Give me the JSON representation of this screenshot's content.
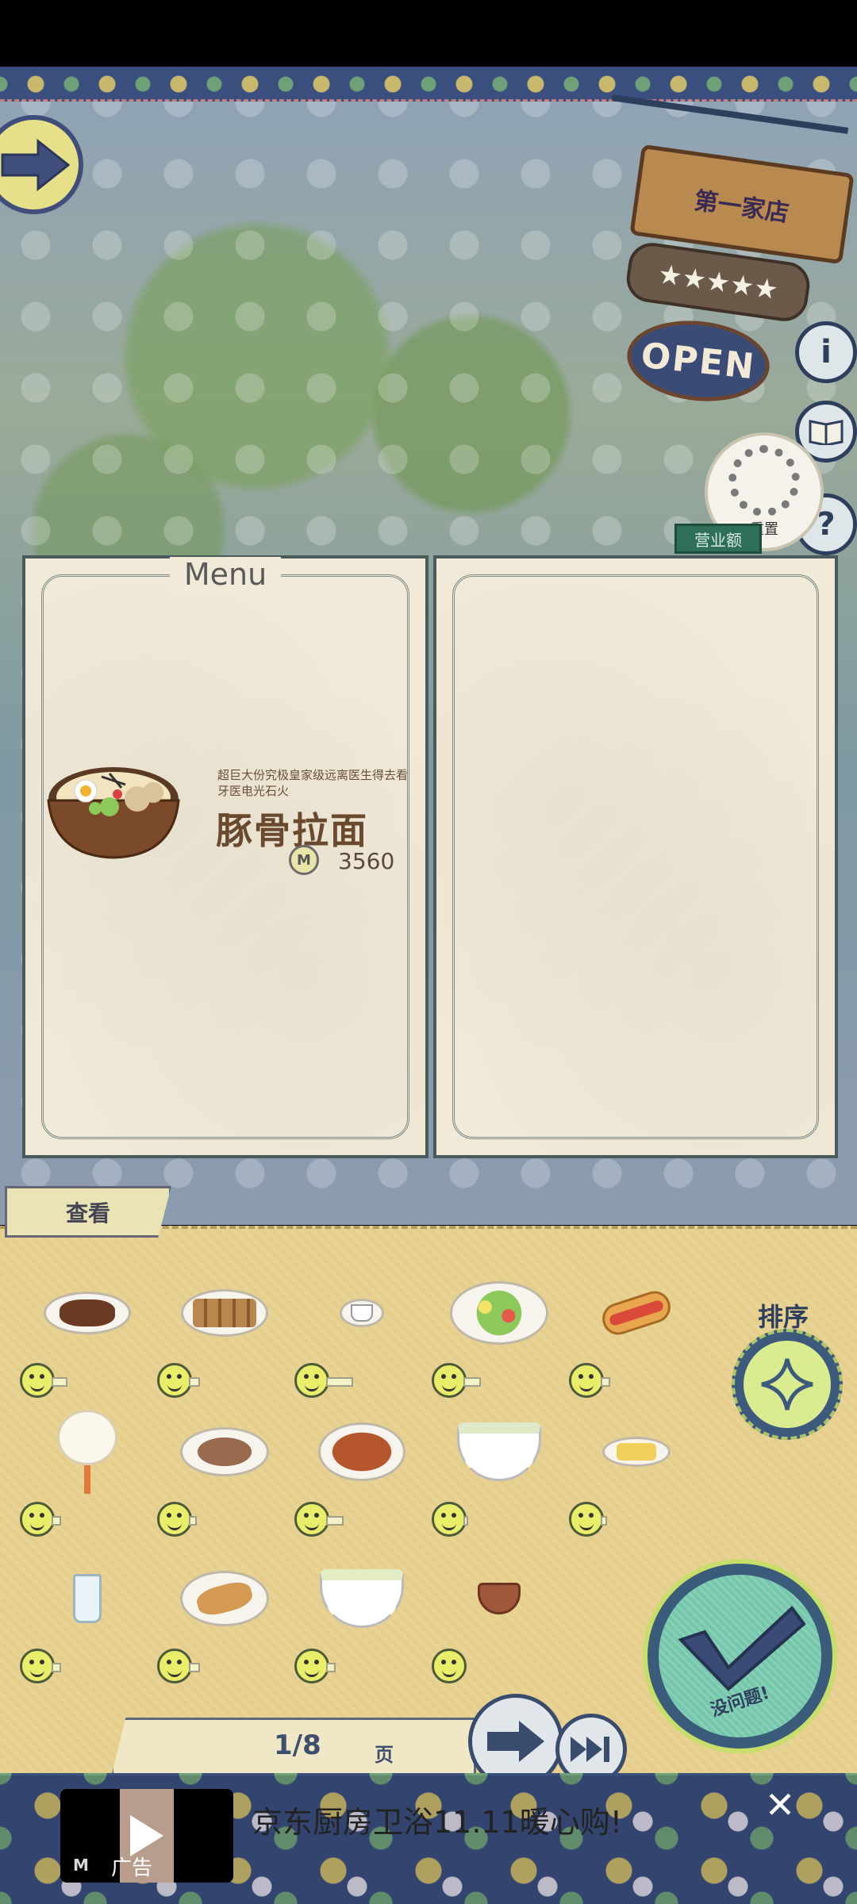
{
  "shop": {
    "name": "第一家店",
    "stars": "★★★★★",
    "open_label": "OPEN",
    "reset_label": "重置",
    "revenue_label": "营业额",
    "info_icon": "i",
    "help_icon": "?"
  },
  "menu": {
    "title": "Menu",
    "dish": {
      "description": "超巨大份究极皇家级远离医生得去看牙医电光石火",
      "name": "豚骨拉面",
      "currency_symbol": "M",
      "price": "3560"
    }
  },
  "panel": {
    "tab_label": "查看",
    "sort_label": "排序",
    "confirm_label": "没问题!",
    "page_number": "1/8",
    "page_unit": "页",
    "items": [
      {
        "name": "braised-meat",
        "level": 0.5
      },
      {
        "name": "skewers",
        "level": 0.35
      },
      {
        "name": "coffee-cup",
        "level": 0.85
      },
      {
        "name": "salad-plate",
        "level": 0.55
      },
      {
        "name": "hot-dog",
        "level": 0.3
      },
      {
        "name": "cotton-candy",
        "level": 0.3
      },
      {
        "name": "tofu-dish",
        "level": 0.25
      },
      {
        "name": "noodle-plate",
        "level": 0.55
      },
      {
        "name": "noodle-soup",
        "level": 0.15
      },
      {
        "name": "egg-roll",
        "level": 0.2
      },
      {
        "name": "glass-of-water",
        "level": 0.3
      },
      {
        "name": "fried-fish",
        "level": 0.35
      },
      {
        "name": "soup-bowl",
        "level": 0.3
      },
      {
        "name": "small-bowl",
        "level": 0.0
      }
    ]
  },
  "ad": {
    "text": "京东厨房卫浴11.11暖心购!",
    "badge": "广告",
    "logo": "M",
    "close": "✕"
  }
}
